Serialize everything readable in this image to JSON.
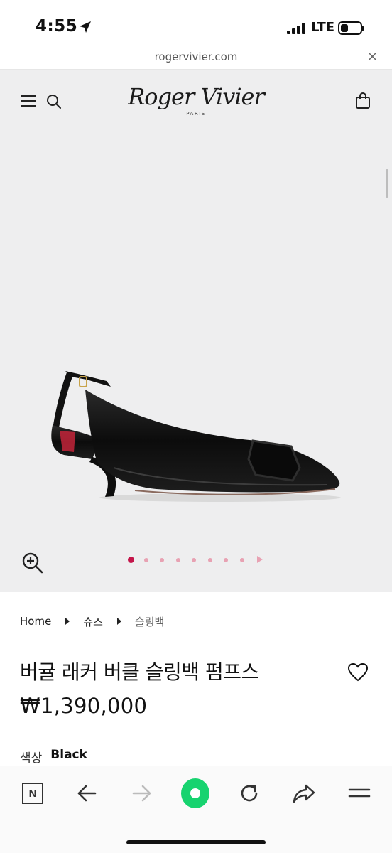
{
  "status_bar": {
    "time": "4:55",
    "network": "LTE",
    "battery_level": 0.4,
    "icons": [
      "location-arrow-icon",
      "signal-icon",
      "battery-icon"
    ]
  },
  "browser": {
    "url": "rogervivier.com",
    "close_glyph": "×"
  },
  "site_header": {
    "brand_name": "Roger Vivier",
    "brand_sub": "PARIS",
    "icons": [
      "menu-icon",
      "search-icon",
      "shopping-bag-icon"
    ]
  },
  "gallery": {
    "image_subject": "black patent slingback pump with buckle",
    "total_images": 9,
    "active_index": 0,
    "accent_color": "#c4154a",
    "dot_color": "#e8a2b3",
    "icons": [
      "zoom-in-icon",
      "next-arrow-icon"
    ]
  },
  "breadcrumb": {
    "items": [
      "Home",
      "슈즈",
      "슬링백"
    ]
  },
  "product": {
    "title": "버귤 래커 버클 슬링백 펌프스",
    "price": "₩1,390,000",
    "color_label": "색상",
    "color_value": "Black",
    "icons": [
      "heart-icon"
    ]
  },
  "toolbar": {
    "n_label": "N",
    "home_color": "#17d36f",
    "icons": [
      "naver-n-icon",
      "back-arrow-icon",
      "forward-arrow-icon",
      "home-circle-icon",
      "reload-icon",
      "share-icon",
      "menu-lines-icon"
    ]
  }
}
